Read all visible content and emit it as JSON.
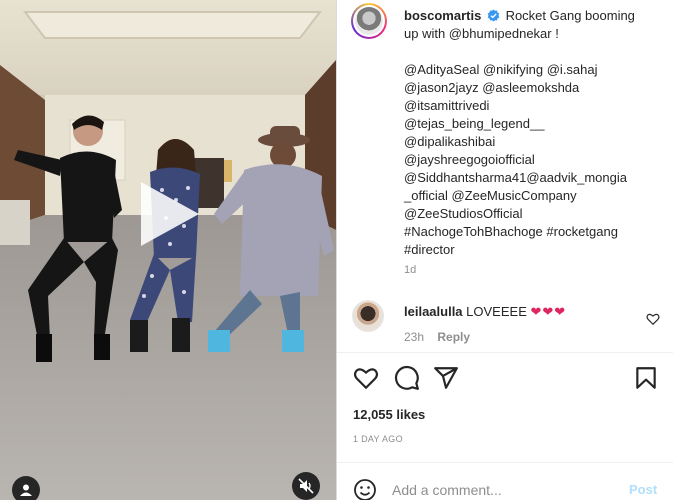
{
  "post": {
    "username": "boscomartis",
    "caption_lines": [
      "Rocket Gang booming",
      "up with @bhumipednekar !",
      "",
      "@AdityaSeal @nikifying @i.sahaj",
      "@jason2jayz @asleemokshda",
      "@itsamittrivedi",
      "@tejas_being_legend__",
      "@dipalikashibai",
      "@jayshreegogoiofficial",
      "@Siddhantsharma41@aadvik_mongia",
      "_official @ZeeMusicCompany",
      "@ZeeStudiosOfficial",
      "#NachogeTohBhachoge #rocketgang",
      "#director"
    ],
    "age": "1d"
  },
  "comment": {
    "username": "leilaalulla",
    "text": "LOVEEEE",
    "hearts": "❤❤❤",
    "age": "23h",
    "reply_label": "Reply"
  },
  "stats": {
    "likes": "12,055 likes",
    "date": "1 DAY AGO"
  },
  "comment_box": {
    "placeholder": "Add a comment...",
    "post_label": "Post"
  },
  "icons": {
    "verified": "verified-badge-icon",
    "like": "heart-icon",
    "comment": "comment-icon",
    "share": "send-icon",
    "save": "bookmark-icon",
    "emoji": "emoji-icon",
    "play": "play-icon",
    "user_tag": "user-tag-icon",
    "mute": "muted-speaker-icon"
  },
  "colors": {
    "verified": "#3897f0",
    "muted_text": "#8e8e8e",
    "post_button": "#b2dffc",
    "heart": "#e0245e"
  }
}
